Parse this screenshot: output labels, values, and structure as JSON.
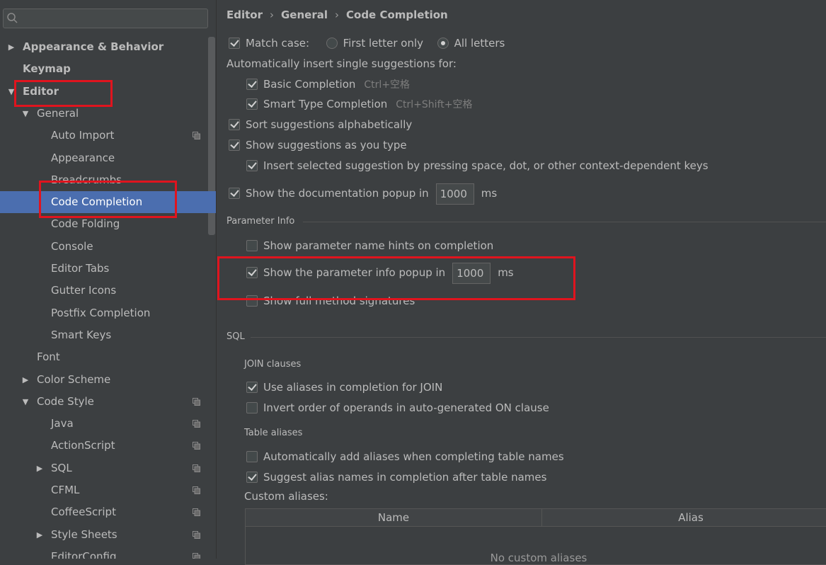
{
  "search": {
    "placeholder": ""
  },
  "tree": [
    {
      "label": "Appearance & Behavior",
      "level": 0,
      "arrow": "right",
      "bold": true
    },
    {
      "label": "Keymap",
      "level": 0,
      "arrow": "",
      "bold": true
    },
    {
      "label": "Editor",
      "level": 0,
      "arrow": "down",
      "bold": true
    },
    {
      "label": "General",
      "level": 1,
      "arrow": "down"
    },
    {
      "label": "Auto Import",
      "level": 2,
      "arrow": "",
      "project": true
    },
    {
      "label": "Appearance",
      "level": 2,
      "arrow": ""
    },
    {
      "label": "Breadcrumbs",
      "level": 2,
      "arrow": ""
    },
    {
      "label": "Code Completion",
      "level": 2,
      "arrow": "",
      "selected": true
    },
    {
      "label": "Code Folding",
      "level": 2,
      "arrow": ""
    },
    {
      "label": "Console",
      "level": 2,
      "arrow": ""
    },
    {
      "label": "Editor Tabs",
      "level": 2,
      "arrow": ""
    },
    {
      "label": "Gutter Icons",
      "level": 2,
      "arrow": ""
    },
    {
      "label": "Postfix Completion",
      "level": 2,
      "arrow": ""
    },
    {
      "label": "Smart Keys",
      "level": 2,
      "arrow": ""
    },
    {
      "label": "Font",
      "level": 1,
      "arrow": ""
    },
    {
      "label": "Color Scheme",
      "level": 1,
      "arrow": "right"
    },
    {
      "label": "Code Style",
      "level": 1,
      "arrow": "down",
      "project": true
    },
    {
      "label": "Java",
      "level": 2,
      "arrow": "",
      "project": true
    },
    {
      "label": "ActionScript",
      "level": 2,
      "arrow": "",
      "project": true
    },
    {
      "label": "SQL",
      "level": 2,
      "arrow": "right",
      "project": true
    },
    {
      "label": "CFML",
      "level": 2,
      "arrow": "",
      "project": true
    },
    {
      "label": "CoffeeScript",
      "level": 2,
      "arrow": "",
      "project": true
    },
    {
      "label": "Style Sheets",
      "level": 2,
      "arrow": "right",
      "project": true
    },
    {
      "label": "EditorConfig",
      "level": 2,
      "arrow": "",
      "project": true
    }
  ],
  "breadcrumb": [
    "Editor",
    "General",
    "Code Completion"
  ],
  "match_case": {
    "label": "Match case:",
    "checked": true,
    "options": [
      {
        "label": "First letter only",
        "checked": false
      },
      {
        "label": "All letters",
        "checked": true
      }
    ]
  },
  "auto_insert": {
    "label": "Automatically insert single suggestions for:",
    "basic": {
      "label": "Basic Completion",
      "shortcut": "Ctrl+空格",
      "checked": true
    },
    "smart": {
      "label": "Smart Type Completion",
      "shortcut": "Ctrl+Shift+空格",
      "checked": true
    }
  },
  "sort_alpha": {
    "label": "Sort suggestions alphabetically",
    "checked": true
  },
  "show_as_type": {
    "label": "Show suggestions as you type",
    "checked": true
  },
  "insert_selected": {
    "label": "Insert selected suggestion by pressing space, dot, or other context-dependent keys",
    "checked": true
  },
  "doc_popup": {
    "label": "Show the documentation popup in",
    "value": "1000",
    "unit": "ms",
    "checked": true
  },
  "param_info": {
    "title": "Parameter Info",
    "name_hints": {
      "label": "Show parameter name hints on completion",
      "checked": false
    },
    "info_popup": {
      "label": "Show the parameter info popup in",
      "value": "1000",
      "unit": "ms",
      "checked": true
    },
    "full_sig": {
      "label": "Show full method signatures",
      "checked": false
    }
  },
  "sql": {
    "title": "SQL",
    "join_title": "JOIN clauses",
    "use_aliases": {
      "label": "Use aliases in completion for JOIN",
      "checked": true
    },
    "invert_order": {
      "label": "Invert order of operands in auto-generated ON clause",
      "checked": false
    },
    "table_title": "Table aliases",
    "auto_add": {
      "label": "Automatically add aliases when completing table names",
      "checked": false
    },
    "suggest_alias": {
      "label": "Suggest alias names in completion after table names",
      "checked": true
    },
    "custom_label": "Custom aliases:",
    "columns": [
      "Name",
      "Alias"
    ],
    "empty_text": "No custom aliases"
  },
  "colors": {
    "background": "#3c3f41",
    "selection": "#4b6eaf",
    "highlight": "#e0141e"
  }
}
